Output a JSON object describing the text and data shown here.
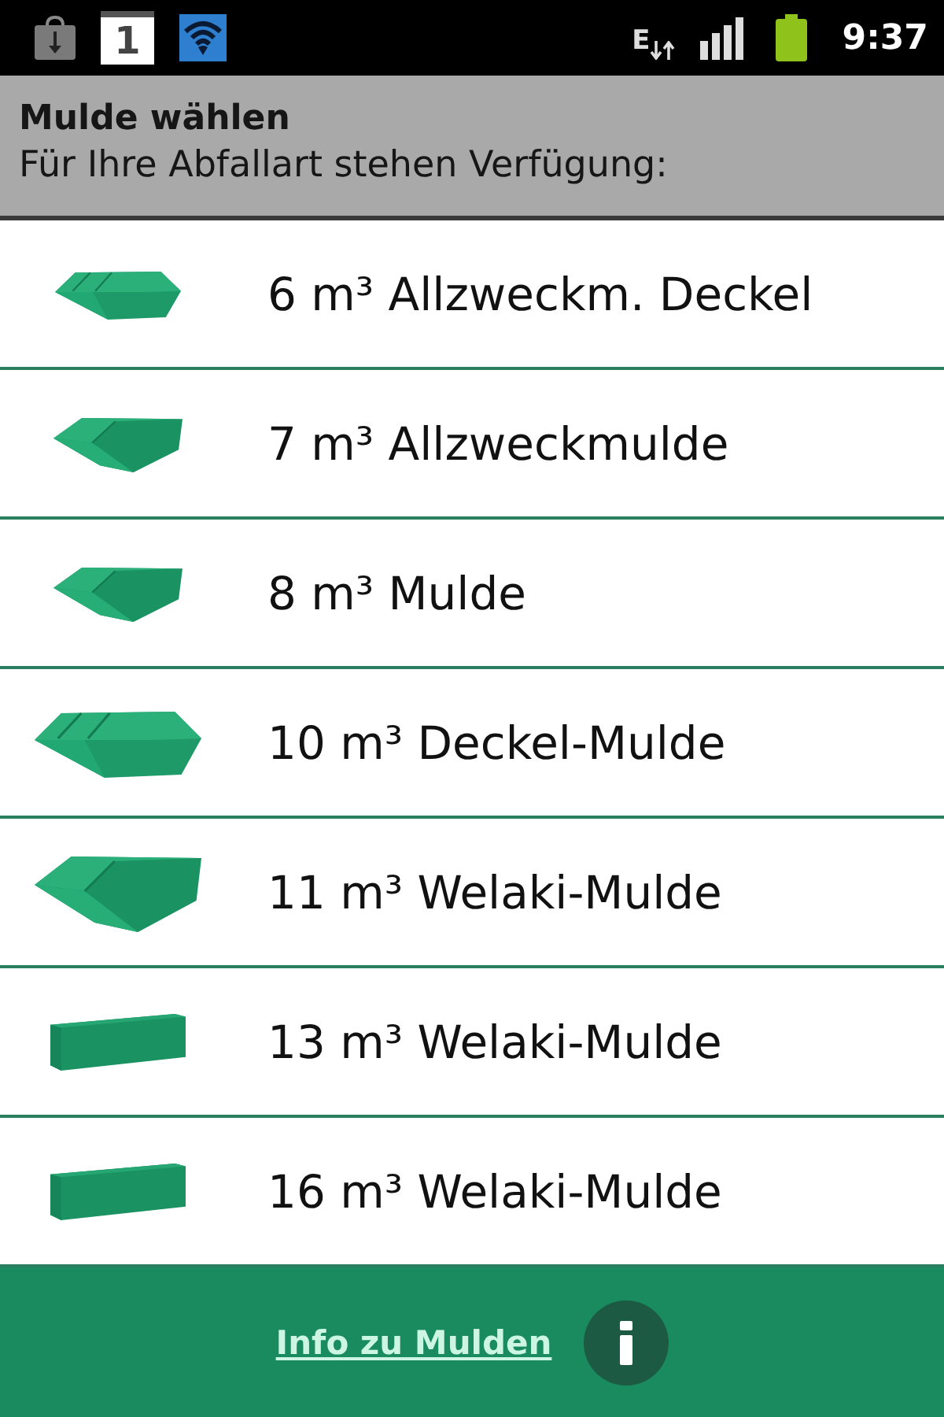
{
  "status_bar": {
    "calendar_day": "1",
    "network_type": "E",
    "time": "9:37"
  },
  "header": {
    "title": "Mulde wählen",
    "subtitle": "Für Ihre Abfallart stehen Verfügung:"
  },
  "containers": [
    {
      "kind": "lid",
      "label": "6 m³ Allzweckm. Deckel"
    },
    {
      "kind": "skip",
      "label": "7 m³ Allzweckmulde"
    },
    {
      "kind": "skip",
      "label": "8 m³ Mulde"
    },
    {
      "kind": "biglid",
      "label": "10 m³ Deckel-Mulde"
    },
    {
      "kind": "bigskip",
      "label": "11 m³ Welaki-Mulde"
    },
    {
      "kind": "box",
      "label": "13 m³ Welaki-Mulde"
    },
    {
      "kind": "box",
      "label": "16 m³ Welaki-Mulde"
    }
  ],
  "footer": {
    "link": "Info zu Mulden"
  }
}
